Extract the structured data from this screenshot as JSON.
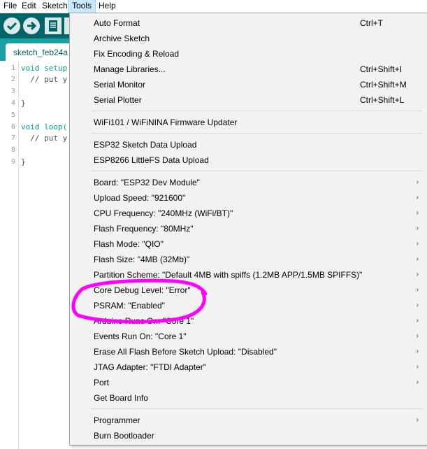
{
  "menubar": {
    "items": [
      {
        "label": "File"
      },
      {
        "label": "Edit"
      },
      {
        "label": "Sketch"
      },
      {
        "label": "Tools"
      },
      {
        "label": "Help"
      }
    ]
  },
  "tab": {
    "title": "sketch_feb24a"
  },
  "editor": {
    "line_numbers": [
      "1",
      "2",
      "3",
      "4",
      "5",
      "6",
      "7",
      "8",
      "9"
    ],
    "code": {
      "l1_kw": "void ",
      "l1_fn": "setup",
      "l2": "  // put y",
      "l4": "}",
      "l6_kw": "void ",
      "l6_fn": "loop(",
      "l7": "  // put y",
      "l9": "}"
    }
  },
  "tools_menu": {
    "items": [
      {
        "label": "Auto Format",
        "shortcut": "Ctrl+T"
      },
      {
        "label": "Archive Sketch",
        "shortcut": ""
      },
      {
        "label": "Fix Encoding & Reload",
        "shortcut": ""
      },
      {
        "label": "Manage Libraries...",
        "shortcut": "Ctrl+Shift+I"
      },
      {
        "label": "Serial Monitor",
        "shortcut": "Ctrl+Shift+M"
      },
      {
        "label": "Serial Plotter",
        "shortcut": "Ctrl+Shift+L"
      },
      {
        "label": "WiFi101 / WiFiNINA Firmware Updater",
        "shortcut": ""
      },
      {
        "label": "ESP32 Sketch Data Upload",
        "shortcut": ""
      },
      {
        "label": "ESP8266 LittleFS Data Upload",
        "shortcut": ""
      },
      {
        "label": "Board: \"ESP32 Dev Module\"",
        "submenu": true
      },
      {
        "label": "Upload Speed: \"921600\"",
        "submenu": true
      },
      {
        "label": "CPU Frequency: \"240MHz (WiFi/BT)\"",
        "submenu": true
      },
      {
        "label": "Flash Frequency: \"80MHz\"",
        "submenu": true
      },
      {
        "label": "Flash Mode: \"QIO\"",
        "submenu": true
      },
      {
        "label": "Flash Size: \"4MB (32Mb)\"",
        "submenu": true
      },
      {
        "label": "Partition Scheme: \"Default 4MB with spiffs (1.2MB APP/1.5MB SPIFFS)\"",
        "submenu": true
      },
      {
        "label": "Core Debug Level: \"Error\"",
        "submenu": true
      },
      {
        "label": "PSRAM: \"Enabled\"",
        "submenu": true
      },
      {
        "label": "Arduino Runs On: \"Core 1\"",
        "submenu": true
      },
      {
        "label": "Events Run On: \"Core 1\"",
        "submenu": true
      },
      {
        "label": "Erase All Flash Before Sketch Upload: \"Disabled\"",
        "submenu": true
      },
      {
        "label": "JTAG Adapter: \"FTDI Adapter\"",
        "submenu": true
      },
      {
        "label": "Port",
        "submenu": true
      },
      {
        "label": "Get Board Info"
      },
      {
        "label": "Programmer",
        "submenu": true
      },
      {
        "label": "Burn Bootloader"
      }
    ],
    "submenu_arrow": "›"
  },
  "toolbar": {
    "icons": [
      "verify-icon",
      "upload-icon",
      "new-icon"
    ]
  },
  "annotation": {
    "color": "#ff00ff",
    "shape": "hand-drawn ellipse around Core Debug Level and PSRAM"
  },
  "colors": {
    "toolbar": "#006468",
    "tabbar": "#17a1a5",
    "menu_highlight": "#cce8ff",
    "annotation": "#ff00ff"
  }
}
